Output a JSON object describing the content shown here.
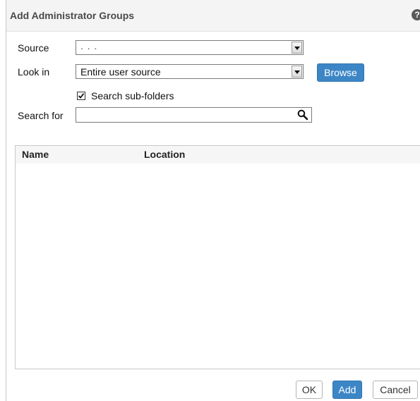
{
  "dialog": {
    "title": "Add Administrator Groups",
    "help_icon": "question-circle-icon",
    "help_glyph": "?"
  },
  "form": {
    "source": {
      "label": "Source",
      "value": ". . ."
    },
    "look_in": {
      "label": "Look in",
      "value": "Entire user source"
    },
    "browse_label": "Browse",
    "search_subfolders": {
      "label": "Search sub-folders",
      "checked": true
    },
    "search_for": {
      "label": "Search for",
      "value": "",
      "placeholder": ""
    }
  },
  "results": {
    "columns": [
      "Name",
      "Location"
    ],
    "rows": []
  },
  "footer": {
    "ok_label": "OK",
    "add_label": "Add",
    "cancel_label": "Cancel"
  },
  "colors": {
    "accent": "#3d86c6",
    "title_bar": "#f4f4f4"
  }
}
